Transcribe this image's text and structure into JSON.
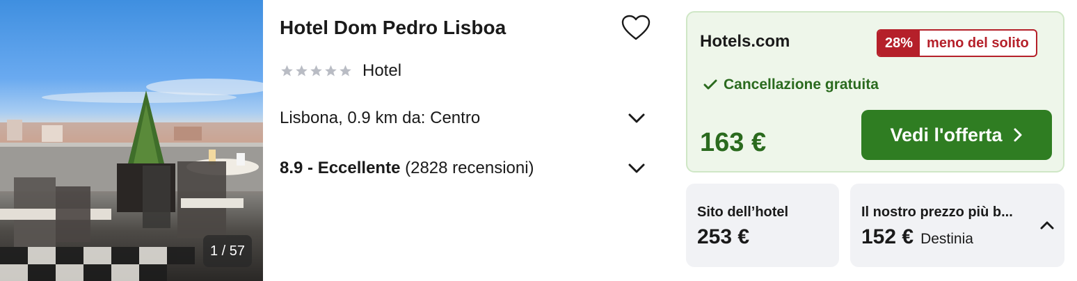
{
  "hotel": {
    "name": "Hotel Dom Pedro Lisboa",
    "type": "Hotel",
    "star_rating": 5,
    "location": "Lisbona, 0.9 km da: Centro",
    "rating_score": "8.9 - Eccellente",
    "rating_reviews": "(2828 recensioni)",
    "photo_counter": "1 / 57"
  },
  "deal": {
    "provider": "Hotels.com",
    "discount_percent": "28%",
    "discount_label": "meno del solito",
    "cancellation": "Cancellazione gratuita",
    "price": "163 €",
    "cta_label": "Vedi l'offerta"
  },
  "alternatives": [
    {
      "title": "Sito dell’hotel",
      "price": "253 €"
    },
    {
      "title": "Il nostro prezzo più b...",
      "price": "152 €",
      "source": "Destinia"
    }
  ],
  "icons": {
    "favorite": "heart-outline-icon",
    "expand": "chevron-down-icon",
    "collapse": "chevron-up-icon",
    "check": "check-icon",
    "cta": "chevron-right-icon"
  },
  "colors": {
    "accent_green": "#2f7d22",
    "deal_bg": "#eef6ea",
    "discount_red": "#b5202a",
    "star_gray": "#b9bcc4",
    "box_bg": "#f1f2f5"
  }
}
